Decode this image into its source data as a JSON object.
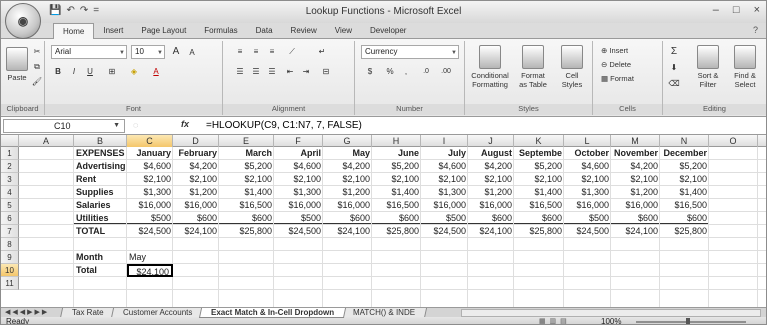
{
  "window": {
    "title": "Lookup Functions - Microsoft Excel",
    "minimize": "–",
    "maximize": "□",
    "close": "×"
  },
  "office_button_glyph": "◉",
  "qat": {
    "save": "💾",
    "undo": "↶",
    "redo": "↷",
    "customize": "="
  },
  "ribbon_tabs": [
    "Home",
    "Insert",
    "Page Layout",
    "Formulas",
    "Data",
    "Review",
    "View",
    "Developer"
  ],
  "active_tab": "Home",
  "help_glyph": "?",
  "clipboard": {
    "paste": "Paste",
    "label": "Clipboard"
  },
  "font": {
    "name": "Arial",
    "size": "10",
    "grow": "A",
    "shrink": "A",
    "bold": "B",
    "italic": "I",
    "underline": "U",
    "label": "Font"
  },
  "alignment": {
    "label": "Alignment"
  },
  "number": {
    "format": "Currency",
    "dollar": "$",
    "percent": "%",
    "comma": ",",
    "inc": ".0",
    "dec": ".00",
    "label": "Number"
  },
  "styles": {
    "conditional": "Conditional",
    "conditional2": "Formatting",
    "format_table": "Format",
    "format_table2": "as Table",
    "cell_styles": "Cell",
    "cell_styles2": "Styles",
    "label": "Styles"
  },
  "cells": {
    "insert": "Insert",
    "delete": "Delete",
    "format": "Format",
    "label": "Cells"
  },
  "editing": {
    "sum": "Σ",
    "sort": "Sort &",
    "sort2": "Filter",
    "find": "Find &",
    "find2": "Select",
    "label": "Editing"
  },
  "name_box": "C10",
  "formula": "=HLOOKUP(C9, C1:N7, 7, FALSE)",
  "fx_label": "fx",
  "columns": [
    "A",
    "B",
    "C",
    "D",
    "E",
    "F",
    "G",
    "H",
    "I",
    "J",
    "K",
    "L",
    "M",
    "N",
    "O"
  ],
  "selected_column": "C",
  "rows": [
    "1",
    "2",
    "3",
    "4",
    "5",
    "6",
    "7",
    "8",
    "9",
    "10",
    "11"
  ],
  "selected_row": "10",
  "table": {
    "header": [
      "EXPENSES",
      "January",
      "February",
      "March",
      "April",
      "May",
      "June",
      "July",
      "August",
      "Septembe",
      "October",
      "November",
      "December"
    ],
    "body": [
      [
        "Advertising",
        "$4,600",
        "$4,200",
        "$5,200",
        "$4,600",
        "$4,200",
        "$5,200",
        "$4,600",
        "$4,200",
        "$5,200",
        "$4,600",
        "$4,200",
        "$5,200"
      ],
      [
        "Rent",
        "$2,100",
        "$2,100",
        "$2,100",
        "$2,100",
        "$2,100",
        "$2,100",
        "$2,100",
        "$2,100",
        "$2,100",
        "$2,100",
        "$2,100",
        "$2,100"
      ],
      [
        "Supplies",
        "$1,300",
        "$1,200",
        "$1,400",
        "$1,300",
        "$1,200",
        "$1,400",
        "$1,300",
        "$1,200",
        "$1,400",
        "$1,300",
        "$1,200",
        "$1,400"
      ],
      [
        "Salaries",
        "$16,000",
        "$16,000",
        "$16,500",
        "$16,000",
        "$16,000",
        "$16,500",
        "$16,000",
        "$16,000",
        "$16,500",
        "$16,000",
        "$16,000",
        "$16,500"
      ],
      [
        "Utilities",
        "$500",
        "$600",
        "$600",
        "$500",
        "$600",
        "$600",
        "$500",
        "$600",
        "$600",
        "$500",
        "$600",
        "$600"
      ],
      [
        "TOTAL",
        "$24,500",
        "$24,100",
        "$25,800",
        "$24,500",
        "$24,100",
        "$25,800",
        "$24,500",
        "$24,100",
        "$25,800",
        "$24,500",
        "$24,100",
        "$25,800"
      ]
    ]
  },
  "lookup": {
    "month_label": "Month",
    "month_value": "May",
    "total_label": "Total",
    "total_value": "$24,100"
  },
  "sheets": [
    "Tax Rate",
    "Customer Accounts",
    "Exact Match & In-Cell Dropdown",
    "MATCH() & INDE"
  ],
  "active_sheet": "Exact Match & In-Cell Dropdown",
  "status": {
    "ready": "Ready",
    "zoom": "100%"
  }
}
